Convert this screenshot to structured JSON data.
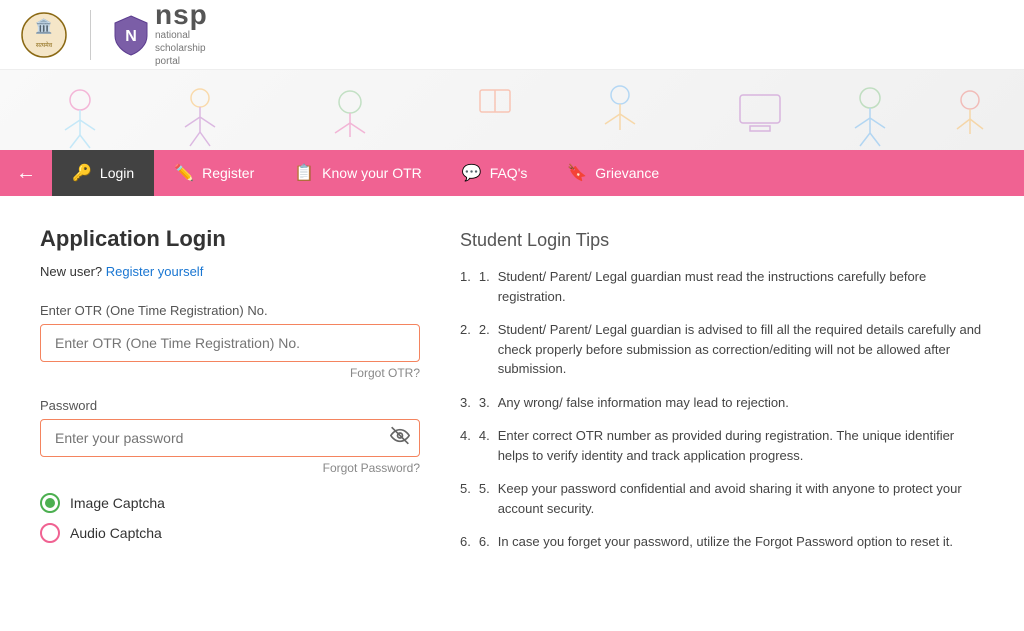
{
  "header": {
    "nsp_title": "nsp",
    "nsp_subtitle_line1": "national",
    "nsp_subtitle_line2": "scholarship",
    "nsp_subtitle_line3": "portal"
  },
  "nav": {
    "back_label": "←",
    "items": [
      {
        "id": "login",
        "label": "Login",
        "icon": "🔑",
        "active": true
      },
      {
        "id": "register",
        "label": "Register",
        "icon": "✏️",
        "active": false
      },
      {
        "id": "know-otr",
        "label": "Know your OTR",
        "icon": "📋",
        "active": false
      },
      {
        "id": "faqs",
        "label": "FAQ's",
        "icon": "💬",
        "active": false
      },
      {
        "id": "grievance",
        "label": "Grievance",
        "icon": "🔖",
        "active": false
      }
    ]
  },
  "form": {
    "title": "Application Login",
    "new_user_text": "New user?",
    "register_link": "Register yourself",
    "otr_label": "Enter OTR (One Time Registration) No.",
    "otr_placeholder": "Enter OTR (One Time Registration) No.",
    "forgot_otr": "Forgot OTR?",
    "password_label": "Password",
    "password_placeholder": "Enter your password",
    "forgot_password": "Forgot Password?",
    "captcha_image_label": "Image Captcha",
    "captcha_audio_label": "Audio Captcha"
  },
  "tips": {
    "title": "Student Login Tips",
    "items": [
      "Student/ Parent/ Legal guardian must read the instructions carefully before registration.",
      "Student/ Parent/ Legal guardian is advised to fill all the required details carefully and check properly before submission as correction/editing will not be allowed after submission.",
      "Any wrong/ false information may lead to rejection.",
      "Enter correct OTR number as provided during registration. The unique identifier helps to verify identity and track application progress.",
      "Keep your password confidential and avoid sharing it with anyone to protect your account security.",
      "In case you forget your password, utilize the Forgot Password option to reset it."
    ]
  }
}
